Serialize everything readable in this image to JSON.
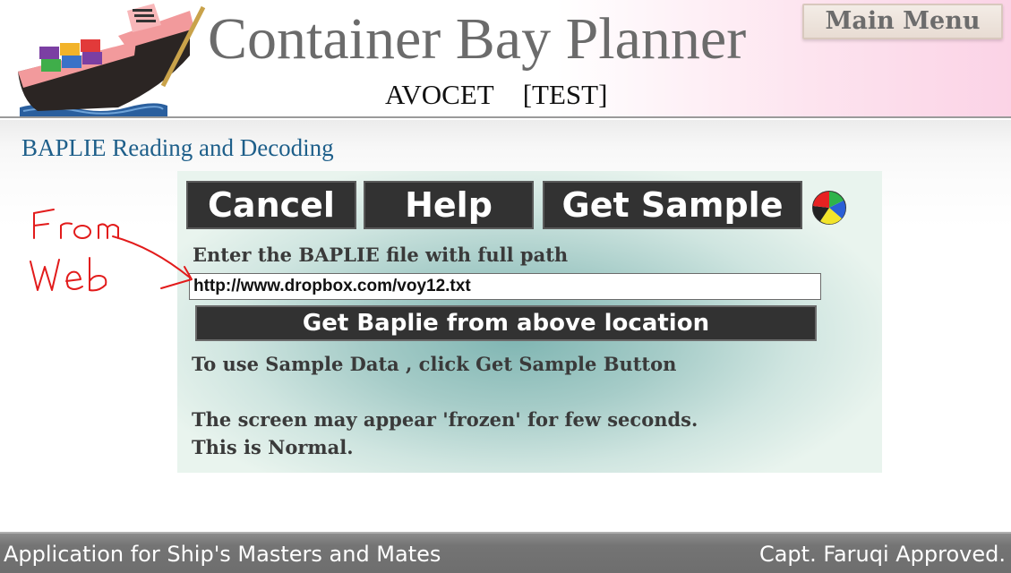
{
  "header": {
    "app_title": "Container Bay Planner",
    "vessel_name": "AVOCET",
    "mode": "[TEST]",
    "main_menu_label": "Main Menu"
  },
  "section": {
    "title": "BAPLIE Reading and Decoding"
  },
  "toolbar": {
    "cancel_label": "Cancel",
    "help_label": "Help",
    "get_sample_label": "Get Sample",
    "icon": "pie-color-icon"
  },
  "form": {
    "prompt": "Enter the BAPLIE file with full path",
    "url_value": "http://www.dropbox.com/voy12.txt",
    "get_baplie_label": "Get Baplie from above location"
  },
  "info": {
    "sample_hint": "To use Sample Data , click Get Sample Button",
    "frozen_warning_line1": "The screen may appear 'frozen' for few seconds.",
    "frozen_warning_line2": "This is Normal."
  },
  "annotation": {
    "text_line1": "From",
    "text_line2": "Web",
    "color": "#e21b1b"
  },
  "footer": {
    "left_text": "Application for Ship's Masters and Mates",
    "right_text": "Capt. Faruqi Approved."
  },
  "colors": {
    "section_title": "#1e5f8a",
    "button_bg": "#323232",
    "footer_bg": "#747474",
    "header_pink": "#fbd3e6"
  }
}
